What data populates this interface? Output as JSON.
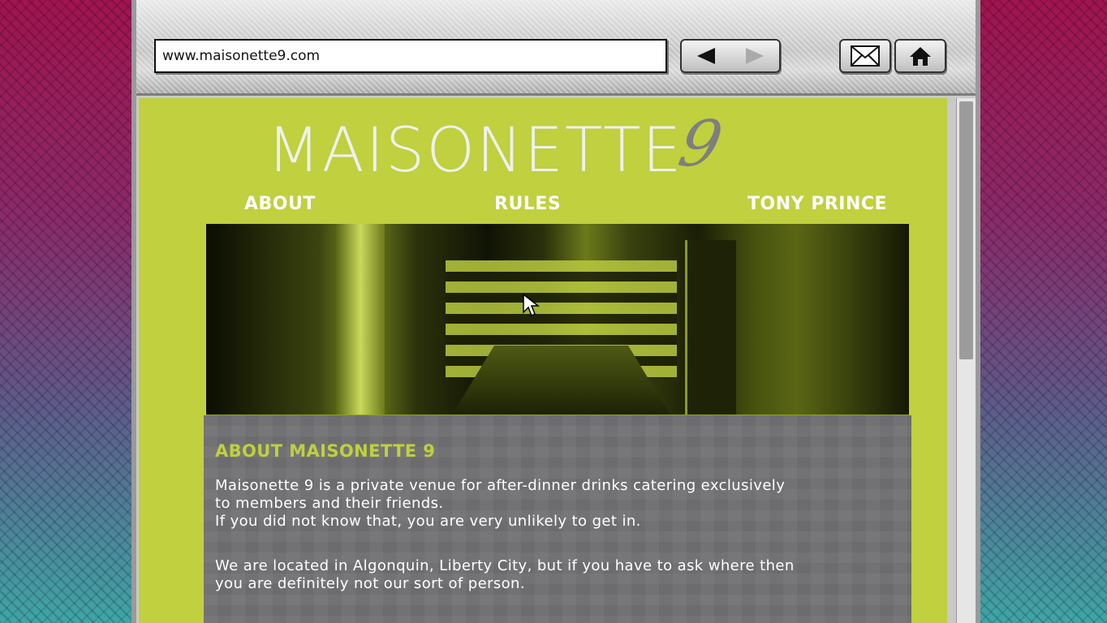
{
  "browser": {
    "address_value": "www.maisonette9.com",
    "back_icon": "back-arrow-icon",
    "forward_icon": "forward-arrow-icon",
    "mail_icon": "mail-icon",
    "home_icon": "home-icon"
  },
  "site": {
    "logo_word": "MAISONETTE",
    "logo_number": "9",
    "menu": [
      "ABOUT",
      "RULES",
      "TONY PRINCE"
    ],
    "section_title": "ABOUT MAISONETTE 9",
    "paragraph1_line1": "Maisonette 9 is a private venue for after-dinner drinks catering exclusively",
    "paragraph1_line2": "to members and their friends.",
    "paragraph1_line3": "If you did not know that, you are very unlikely to get in.",
    "paragraph2_line1": "We are located in Algonquin, Liberty City, but if you have to ask where then",
    "paragraph2_line2": "you are definitely not our sort of person."
  },
  "colors": {
    "page_background": "#c0d03e",
    "content_panel": "#6c6c6e",
    "accent_text": "#c0d03e"
  }
}
